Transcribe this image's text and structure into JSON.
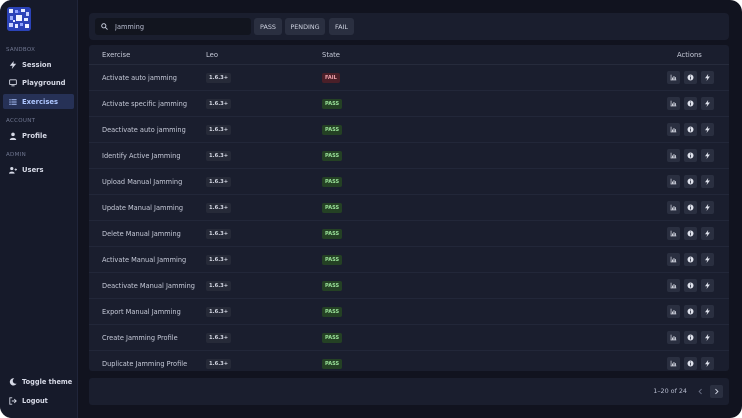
{
  "colors": {
    "background": "#11131f",
    "sidebar": "#161a2a",
    "panel": "#1a1e2e",
    "active_nav": "#263156",
    "pass_bg": "#244124",
    "pass_text": "#9be39a",
    "fail_bg": "#4a1f28",
    "fail_text": "#f0a2ac"
  },
  "sidebar": {
    "sections": [
      {
        "label": "SANDBOX",
        "items": [
          {
            "label": "Session",
            "icon": "lightning-icon",
            "active": false
          },
          {
            "label": "Playground",
            "icon": "monitor-icon",
            "active": false
          },
          {
            "label": "Exercises",
            "icon": "list-icon",
            "active": true
          }
        ]
      },
      {
        "label": "ACCOUNT",
        "items": [
          {
            "label": "Profile",
            "icon": "person-icon",
            "active": false
          }
        ]
      },
      {
        "label": "ADMIN",
        "items": [
          {
            "label": "Users",
            "icon": "users-icon",
            "active": false
          }
        ]
      }
    ],
    "bottom": [
      {
        "label": "Toggle theme",
        "icon": "moon-icon"
      },
      {
        "label": "Logout",
        "icon": "logout-icon"
      }
    ]
  },
  "search": {
    "value": "Jamming",
    "placeholder": "Search",
    "icon": "search-icon"
  },
  "filters": [
    "PASS",
    "PENDING",
    "FAIL"
  ],
  "table": {
    "columns": [
      "Exercise",
      "Leo",
      "State",
      "Actions"
    ],
    "action_icons": [
      "chart-icon",
      "info-icon",
      "lightning-icon"
    ],
    "rows": [
      {
        "exercise": "Activate auto jamming",
        "leo": "1.6.3+",
        "state": "FAIL"
      },
      {
        "exercise": "Activate specific jamming",
        "leo": "1.6.3+",
        "state": "PASS"
      },
      {
        "exercise": "Deactivate auto jamming",
        "leo": "1.6.3+",
        "state": "PASS"
      },
      {
        "exercise": "Identify Active Jamming",
        "leo": "1.6.3+",
        "state": "PASS"
      },
      {
        "exercise": "Upload Manual Jamming",
        "leo": "1.6.3+",
        "state": "PASS"
      },
      {
        "exercise": "Update Manual Jamming",
        "leo": "1.6.3+",
        "state": "PASS"
      },
      {
        "exercise": "Delete Manual Jamming",
        "leo": "1.6.3+",
        "state": "PASS"
      },
      {
        "exercise": "Activate Manual Jamming",
        "leo": "1.6.3+",
        "state": "PASS"
      },
      {
        "exercise": "Deactivate Manual Jamming",
        "leo": "1.6.3+",
        "state": "PASS"
      },
      {
        "exercise": "Export Manual Jamming",
        "leo": "1.6.3+",
        "state": "PASS"
      },
      {
        "exercise": "Create Jamming Profile",
        "leo": "1.6.3+",
        "state": "PASS"
      },
      {
        "exercise": "Duplicate Jamming Profile",
        "leo": "1.6.3+",
        "state": "PASS"
      }
    ]
  },
  "pagination": {
    "text": "1–20 of 24"
  }
}
